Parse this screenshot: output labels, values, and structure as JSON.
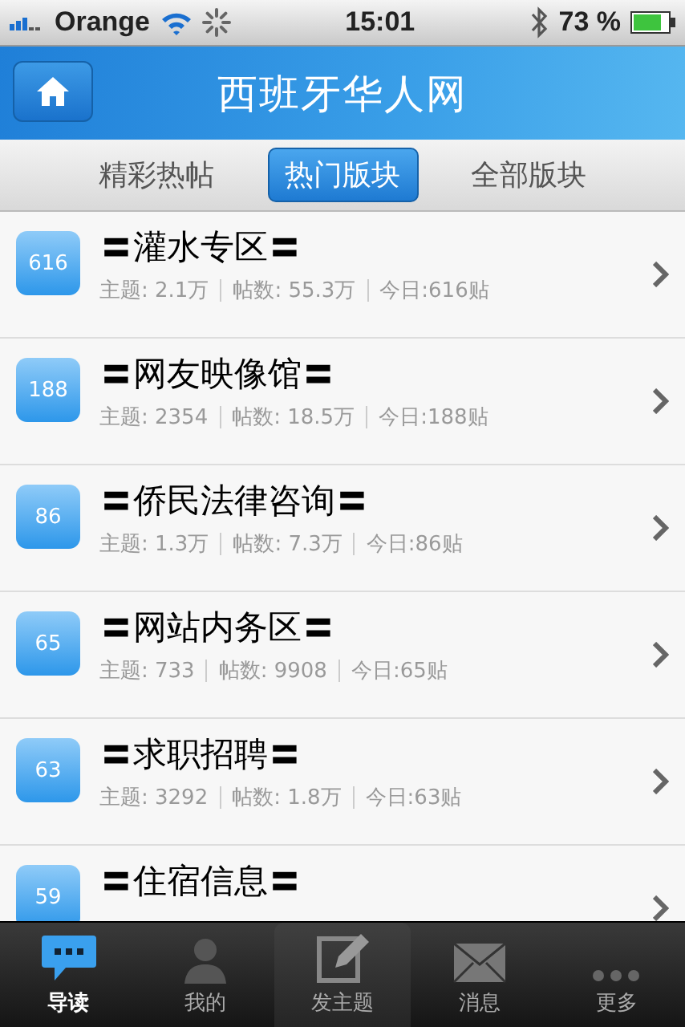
{
  "status_bar": {
    "carrier": "Orange",
    "time": "15:01",
    "battery": "73 %"
  },
  "header": {
    "title": "西班牙华人网"
  },
  "tabs": [
    {
      "label": "精彩热帖",
      "selected": false
    },
    {
      "label": "热门版块",
      "selected": true
    },
    {
      "label": "全部版块",
      "selected": false
    }
  ],
  "forums": [
    {
      "badge": "616",
      "title": "〓灌水专区〓",
      "stats": [
        "主题: 2.1万",
        "帖数: 55.3万",
        "今日:616贴"
      ]
    },
    {
      "badge": "188",
      "title": "〓网友映像馆〓",
      "stats": [
        "主题: 2354",
        "帖数: 18.5万",
        "今日:188贴"
      ]
    },
    {
      "badge": "86",
      "title": "〓侨民法律咨询〓",
      "stats": [
        "主题: 1.3万",
        "帖数: 7.3万",
        "今日:86贴"
      ]
    },
    {
      "badge": "65",
      "title": "〓网站内务区〓",
      "stats": [
        "主题: 733",
        "帖数: 9908",
        "今日:65贴"
      ]
    },
    {
      "badge": "63",
      "title": "〓求职招聘〓",
      "stats": [
        "主题: 3292",
        "帖数: 1.8万",
        "今日:63贴"
      ]
    },
    {
      "badge": "59",
      "title": "〓住宿信息〓"
    }
  ],
  "tab_bar": [
    {
      "label": "导读",
      "kind": "chat",
      "selected": true
    },
    {
      "label": "我的",
      "kind": "person",
      "selected": false
    },
    {
      "label": "发主题",
      "kind": "compose",
      "selected": false
    },
    {
      "label": "消息",
      "kind": "mail",
      "selected": false
    },
    {
      "label": "更多",
      "kind": "more",
      "selected": false
    }
  ]
}
